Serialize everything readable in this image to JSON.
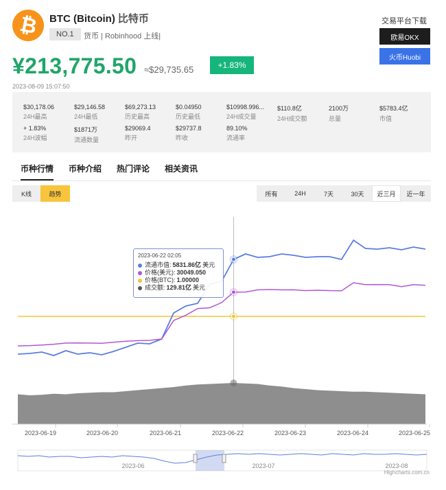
{
  "coin": {
    "logo_symbol": "₿",
    "name": "BTC (Bitcoin)",
    "cn_name": "比特币",
    "rank": "NO.1",
    "meta": "货币 | Robinhood 上线|"
  },
  "download": {
    "title": "交易平台下载",
    "okx": "欧易OKX",
    "huobi": "火币Huobi"
  },
  "price": {
    "cny": "¥213,775.50",
    "usd": "≈$29,735.65",
    "change": "+1.83%",
    "time": "2023-08-09 15:07:50"
  },
  "stats": [
    {
      "value": "$30,178.06",
      "label": "24H最高"
    },
    {
      "value": "$29,146.58",
      "label": "24H最低"
    },
    {
      "value": "$69,273.13",
      "label": "历史最高"
    },
    {
      "value": "$0.04950",
      "label": "历史最低"
    },
    {
      "value": "$10998.996...",
      "label": "24H成交量"
    },
    {
      "value": "$110.8亿",
      "label": "24H成交额"
    },
    {
      "value": "2100万",
      "label": "总量"
    },
    {
      "value": "$5783.4亿",
      "label": "市值"
    },
    {
      "value": "+ 1.83%",
      "label": "24H波幅"
    },
    {
      "value": "$1871万",
      "label": "流通数量"
    },
    {
      "value": "$29069.4",
      "label": "昨开"
    },
    {
      "value": "$29737.8",
      "label": "昨收"
    },
    {
      "value": "89.10%",
      "label": "流通率"
    }
  ],
  "tabs": [
    "币种行情",
    "币种介绍",
    "热门评论",
    "相关资讯"
  ],
  "chart_type": {
    "kline": "K线",
    "trend": "趋势"
  },
  "ranges": [
    "所有",
    "24H",
    "7天",
    "30天",
    "近三月",
    "近一年"
  ],
  "colors": {
    "accent_green": "#20a56a",
    "badge_green": "#16b57b",
    "market_cap": "#5b7de0",
    "price_usd": "#b057d2",
    "price_btc": "#f2c537",
    "volume": "#8e8e8e"
  },
  "tooltip": {
    "time": "2023-06-22 02:05",
    "rows": [
      {
        "label": "流通市值:",
        "value": "5831.86亿",
        "unit": "美元"
      },
      {
        "label": "价格(美元):",
        "value": "30049.050",
        "unit": ""
      },
      {
        "label": "价格(BTC):",
        "value": "1.00000",
        "unit": ""
      },
      {
        "label": "成交额:",
        "value": "129.81亿",
        "unit": "美元"
      }
    ]
  },
  "credit": "Highcharts.com.cn",
  "chart_data": {
    "type": "line",
    "x_ticks": [
      "2023-06-19",
      "2023-06-20",
      "2023-06-21",
      "2023-06-22",
      "2023-06-23",
      "2023-06-24",
      "2023-06-25"
    ],
    "x": [
      18.5,
      18.7,
      18.9,
      19.1,
      19.3,
      19.5,
      19.7,
      19.9,
      20.1,
      20.3,
      20.5,
      20.7,
      20.9,
      21.1,
      21.3,
      21.5,
      21.7,
      21.9,
      22.1,
      22.3,
      22.5,
      22.7,
      22.9,
      23.1,
      23.3,
      23.5,
      23.7,
      23.9,
      24.1,
      24.3,
      24.5,
      24.7,
      24.9,
      25.1,
      25.3
    ],
    "series": [
      {
        "values": [
          5150,
          5155,
          5165,
          5140,
          5175,
          5150,
          5160,
          5145,
          5170,
          5200,
          5230,
          5225,
          5260,
          5450,
          5500,
          5520,
          5660,
          5680,
          5840,
          5880,
          5855,
          5860,
          5880,
          5870,
          5855,
          5860,
          5860,
          5840,
          5980,
          5920,
          5915,
          5925,
          5910,
          5930,
          5915
        ]
      },
      {
        "values": [
          26450,
          26470,
          26510,
          26560,
          26640,
          26650,
          26640,
          26620,
          26700,
          26760,
          26800,
          26820,
          26910,
          28150,
          28500,
          28950,
          29000,
          29350,
          30049,
          30060,
          30200,
          30230,
          30200,
          30210,
          30150,
          30180,
          30150,
          30140,
          30680,
          30550,
          30560,
          30550,
          30420,
          30550,
          30510
        ]
      },
      {
        "values": [
          1,
          1,
          1,
          1,
          1,
          1,
          1,
          1,
          1,
          1,
          1,
          1,
          1,
          1,
          1,
          1,
          1,
          1,
          1,
          1,
          1,
          1,
          1,
          1,
          1,
          1,
          1,
          1,
          1,
          1,
          1,
          1,
          1,
          1,
          1
        ]
      },
      {
        "values": [
          58,
          56,
          57,
          59,
          58,
          60,
          61,
          62,
          62,
          64,
          66,
          68,
          70,
          72,
          75,
          77,
          78,
          79,
          80,
          79,
          78,
          75,
          73,
          70,
          68,
          66,
          65,
          64,
          63,
          63,
          62,
          61,
          60,
          59,
          58
        ]
      }
    ],
    "navigator_ticks": [
      "2023-06",
      "2023-07",
      "2023-08"
    ]
  }
}
